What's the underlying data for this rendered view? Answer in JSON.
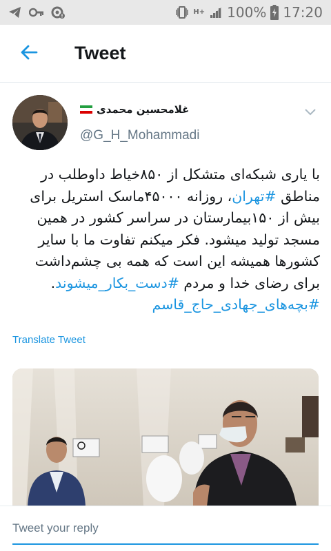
{
  "status_bar": {
    "icons_left": [
      "telegram-icon",
      "key-icon",
      "settings-alert-icon"
    ],
    "network_label": "H+",
    "battery_percent": "100%",
    "time": "17:20"
  },
  "header": {
    "title": "Tweet",
    "back_icon": "arrow-left-icon"
  },
  "author": {
    "display_name": "غلامحسین محمدی",
    "flag": "iran-flag-icon",
    "handle": "@G_H_Mohammadi"
  },
  "tweet": {
    "segments": [
      {
        "text": "با یاری شبکه‌ای متشکل از ۸۵۰خیاط داوطلب در مناطق ",
        "hashtag": false
      },
      {
        "text": "#تهران",
        "hashtag": true
      },
      {
        "text": "، روزانه ۴۵۰۰۰ماسک استریل برای بیش از ۱۵۰بیمارستان در سراسر کشور در همین مسجد تولید میشود. فکر میکنم تفاوت ما با سایر کشورها همیشه این است که همه بی چشم‌داشت برای رضای خدا و مردم ",
        "hashtag": false
      },
      {
        "text": "#دست_بکار_میشوند",
        "hashtag": true
      },
      {
        "text": ". ",
        "hashtag": false
      },
      {
        "text": "#بچه‌های_جهادی_حاج_قاسم",
        "hashtag": true
      }
    ],
    "translate_label": "Translate Tweet"
  },
  "reply": {
    "placeholder": "Tweet your reply"
  },
  "colors": {
    "accent": "#1b95e0",
    "muted": "#657786",
    "status_bar_bg": "#e8e8e8"
  }
}
